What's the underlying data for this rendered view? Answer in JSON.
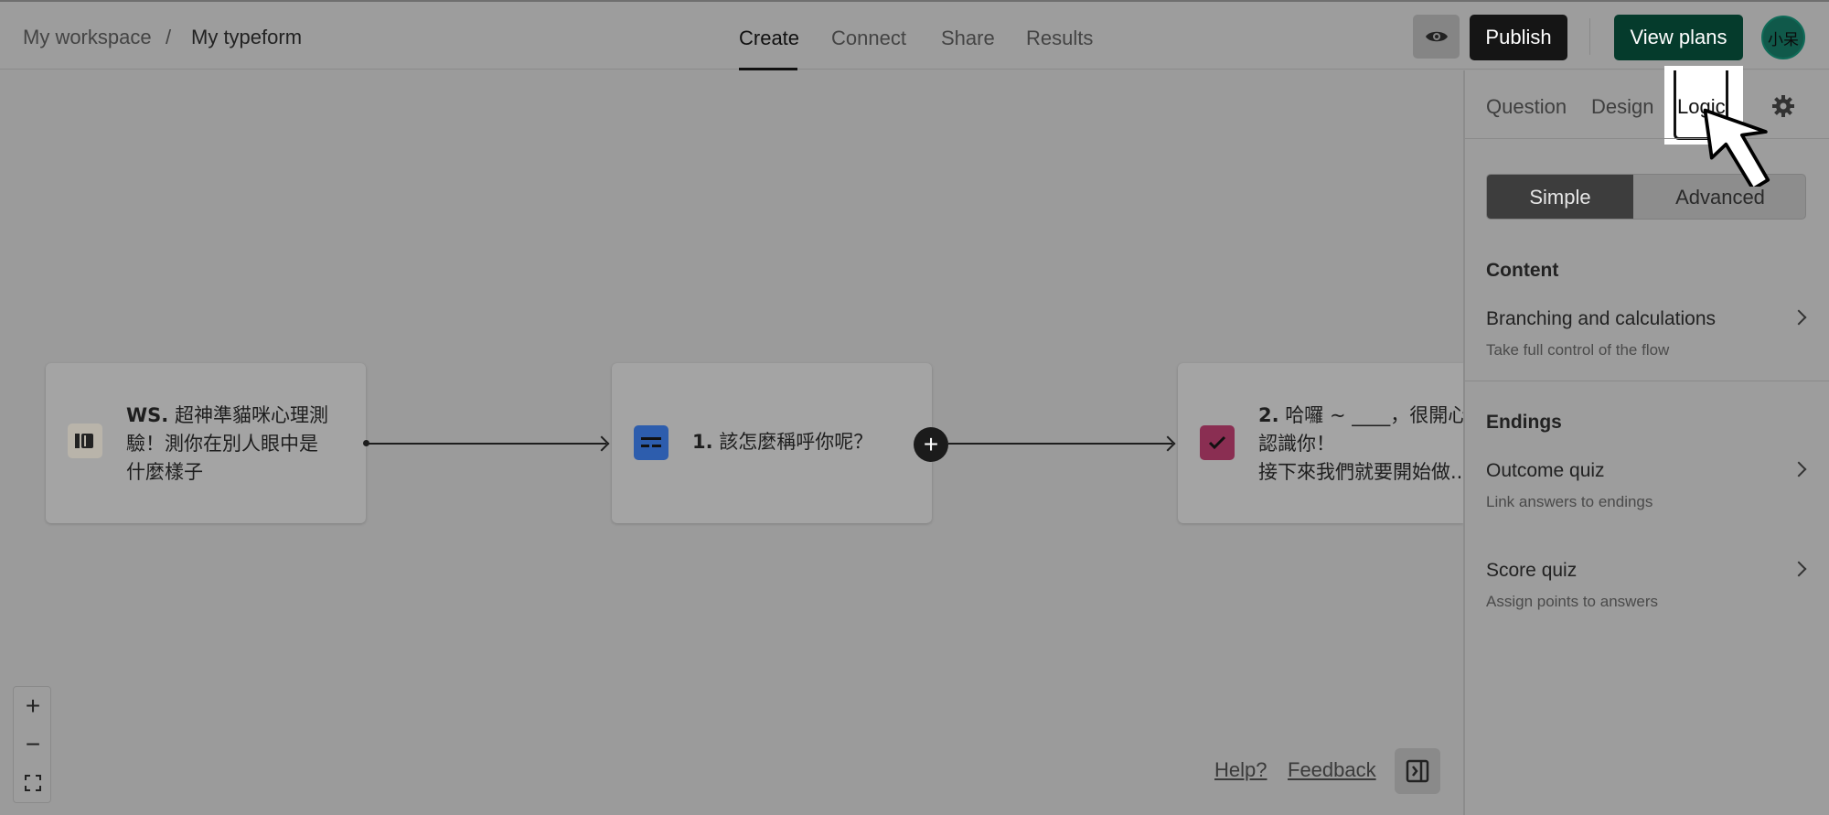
{
  "breadcrumb": {
    "workspace": "My workspace",
    "separator": "/",
    "form": "My typeform"
  },
  "nav": {
    "tabs": [
      "Create",
      "Connect",
      "Share",
      "Results"
    ],
    "active": "Create"
  },
  "header": {
    "publish_label": "Publish",
    "view_plans_label": "View plans",
    "avatar_text": "小呆"
  },
  "canvas": {
    "cards": [
      {
        "number": "WS.",
        "text_lines": [
          "超神準貓咪心理測",
          "驗！測你在別人眼中是",
          "什麼樣子"
        ],
        "icon": "welcome-screen-icon"
      },
      {
        "number": "1.",
        "text_lines": [
          "該怎麼稱呼你呢？"
        ],
        "icon": "short-text-icon"
      },
      {
        "number": "2.",
        "text_lines": [
          "哈囉 ~ ____，很開心",
          "認識你！",
          "接下來我們就要開始做..."
        ],
        "icon": "checkbox-icon"
      }
    ],
    "add_symbol": "+"
  },
  "zoom": {
    "in": "+",
    "out": "−"
  },
  "footer": {
    "help": "Help?",
    "feedback": "Feedback"
  },
  "panel": {
    "tabs": {
      "question": "Question",
      "design": "Design",
      "logic": "Logic"
    },
    "mode": {
      "simple": "Simple",
      "advanced": "Advanced",
      "selected": "Simple"
    },
    "content_heading": "Content",
    "branching": {
      "title": "Branching and calculations",
      "subtitle": "Take full control of the flow"
    },
    "endings_heading": "Endings",
    "outcome": {
      "title": "Outcome quiz",
      "subtitle": "Link answers to endings"
    },
    "score": {
      "title": "Score quiz",
      "subtitle": "Assign points to answers"
    }
  },
  "colors": {
    "publish": "#151515",
    "view_plans": "#053b2c",
    "avatar": "#10594a",
    "q1_icon": "#2d5dad",
    "q2_icon": "#8a2e52"
  }
}
